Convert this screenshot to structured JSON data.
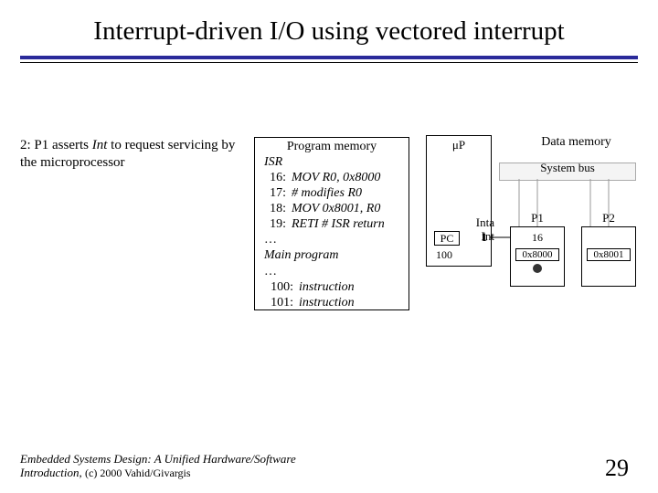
{
  "title": "Interrupt-driven I/O using vectored interrupt",
  "step": {
    "prefix": "2: P1 asserts ",
    "int": "Int",
    "suffix": " to request servicing by the microprocessor"
  },
  "progmem": {
    "header": "Program memory",
    "isr_label": "ISR",
    "rows": [
      {
        "ln": "16:",
        "txt": "MOV R0, 0x8000"
      },
      {
        "ln": "17:",
        "txt": "# modifies R0"
      },
      {
        "ln": "18:",
        "txt": "MOV 0x8001, R0"
      },
      {
        "ln": "19:",
        "txt": "RETI  # ISR return"
      }
    ],
    "main_label": "Main program",
    "main_rows": [
      {
        "ln": "100:",
        "txt": "instruction"
      },
      {
        "ln": "101:",
        "txt": "instruction"
      }
    ]
  },
  "mup": {
    "label": "μP",
    "sig1": "Inta",
    "sig2": "Int",
    "pc_label": "PC",
    "one": "1",
    "pc_value": "100"
  },
  "datamem": "Data memory",
  "sysbus": "System bus",
  "p1": {
    "name": "P1",
    "line1": "16",
    "addr": "0x8000"
  },
  "p2": {
    "name": "P2",
    "addr": "0x8001"
  },
  "footer": {
    "book": "Embedded Systems Design: A Unified Hardware/Software Introduction,",
    "copy": " (c) 2000 Vahid/Givargis"
  },
  "page": "29"
}
